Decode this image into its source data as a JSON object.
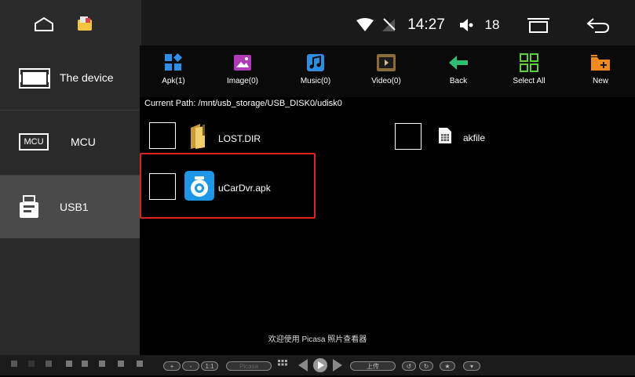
{
  "status": {
    "time": "14:27",
    "volume": "18"
  },
  "sidebar": {
    "items": [
      {
        "label": "The device",
        "icon": "screen-icon"
      },
      {
        "label": "MCU",
        "icon": "mcu-chip-icon",
        "badge": "MCU"
      },
      {
        "label": "USB1",
        "icon": "usb-drive-icon"
      }
    ],
    "active": "USB1"
  },
  "toolbar": {
    "apk": "Apk(1)",
    "image": "Image(0)",
    "music": "Music(0)",
    "video": "Video(0)",
    "back": "Back",
    "select_all": "Select All",
    "new": "New"
  },
  "path": {
    "label": "Current Path:",
    "value": "/mnt/usb_storage/USB_DISK0/udisk0"
  },
  "files": [
    {
      "name": "LOST.DIR",
      "icon": "folder-icon"
    },
    {
      "name": "akfile",
      "icon": "document-icon"
    },
    {
      "name": "uCarDvr.apk",
      "icon": "camera-app-icon"
    }
  ],
  "picasa_bar": {
    "welcome": "欢迎使用 Picasa 照片查看器",
    "zoom_in": "+",
    "zoom_out": "-",
    "actual_size": "1:1",
    "picasa": "Picasa",
    "upload": "上传"
  },
  "colors": {
    "apk_blue": "#2f8fe8",
    "image_purple": "#b03ab8",
    "music_blue": "#2e8fe2",
    "video_tan": "#8a6d3b",
    "back_green": "#2fbf71",
    "select_green": "#5fcf3f",
    "new_orange": "#f08a1c",
    "highlight_red": "#d22222"
  }
}
